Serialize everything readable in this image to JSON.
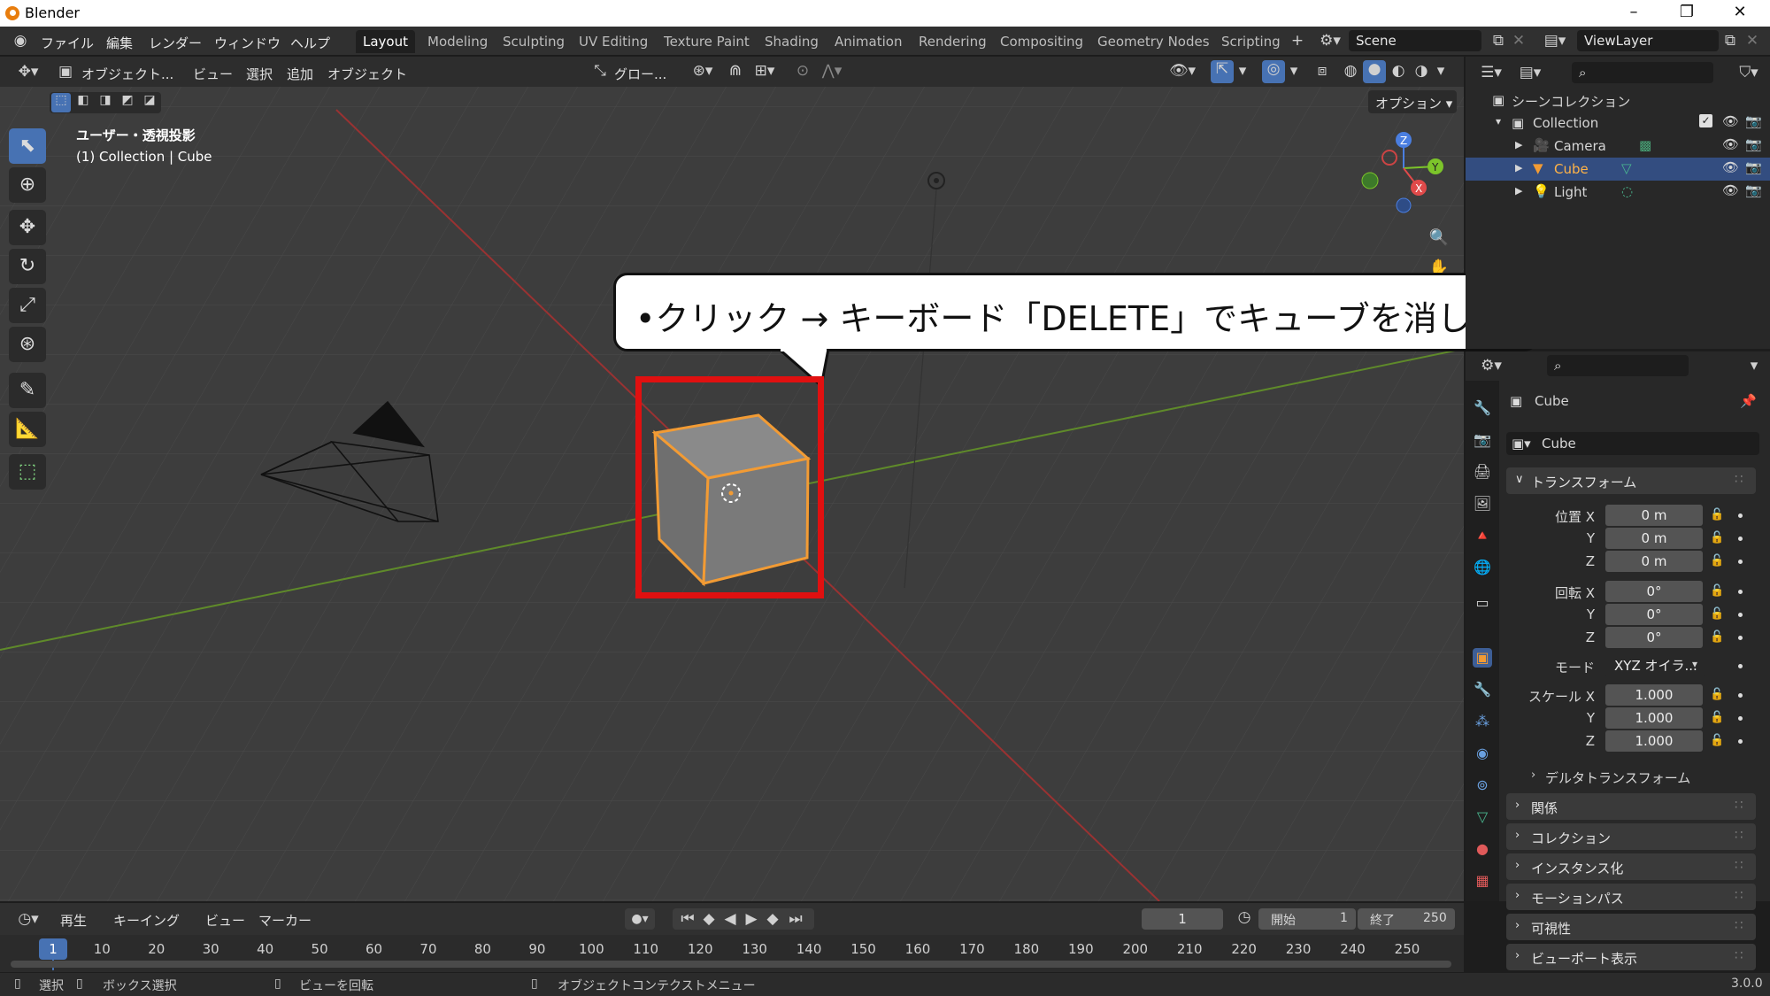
{
  "app": {
    "title": "Blender",
    "version": "3.0.0"
  },
  "menus": [
    "ファイル",
    "編集",
    "レンダー",
    "ウィンドウ",
    "ヘルプ"
  ],
  "workspaces": [
    {
      "label": "Layout",
      "active": true
    },
    {
      "label": "Modeling"
    },
    {
      "label": "Sculpting"
    },
    {
      "label": "UV Editing"
    },
    {
      "label": "Texture Paint"
    },
    {
      "label": "Shading"
    },
    {
      "label": "Animation"
    },
    {
      "label": "Rendering"
    },
    {
      "label": "Compositing"
    },
    {
      "label": "Geometry Nodes"
    },
    {
      "label": "Scripting"
    }
  ],
  "scene": {
    "name": "Scene"
  },
  "view_layer": {
    "name": "ViewLayer"
  },
  "viewport_header": {
    "mode": "オブジェクト...",
    "menus": [
      "ビュー",
      "選択",
      "追加",
      "オブジェクト"
    ],
    "orientation": "グロー...",
    "options": "オプション"
  },
  "viewport": {
    "view_name": "ユーザー・透視投影",
    "collection_info": "(1) Collection | Cube"
  },
  "instruction": {
    "text": "•クリック → キーボード「DELETE」でキューブを消してください"
  },
  "outliner": {
    "root": "シーンコレクション",
    "collection": "Collection",
    "items": [
      {
        "name": "Camera",
        "selected": false
      },
      {
        "name": "Cube",
        "selected": true
      },
      {
        "name": "Light",
        "selected": false
      }
    ]
  },
  "properties": {
    "object_name": "Cube",
    "data_name": "Cube",
    "transform_label": "トランスフォーム",
    "location": {
      "label_x": "位置 X",
      "label_y": "Y",
      "label_z": "Z",
      "x": "0 m",
      "y": "0 m",
      "z": "0 m"
    },
    "rotation": {
      "label_x": "回転 X",
      "label_y": "Y",
      "label_z": "Z",
      "x": "0°",
      "y": "0°",
      "z": "0°"
    },
    "mode": {
      "label": "モード",
      "value": "XYZ オイラ..."
    },
    "scale": {
      "label_x": "スケール X",
      "label_y": "Y",
      "label_z": "Z",
      "x": "1.000",
      "y": "1.000",
      "z": "1.000"
    },
    "delta_transform": "デルタトランスフォーム",
    "sections": [
      "関係",
      "コレクション",
      "インスタンス化",
      "モーションパス",
      "可視性",
      "ビューポート表示"
    ]
  },
  "timeline": {
    "menus": [
      "再生",
      "キーイング",
      "ビュー",
      "マーカー"
    ],
    "current_frame": "1",
    "start_label": "開始",
    "start": "1",
    "end_label": "終了",
    "end": "250",
    "ticks": [
      "1",
      "10",
      "20",
      "30",
      "40",
      "50",
      "60",
      "70",
      "80",
      "90",
      "100",
      "110",
      "120",
      "130",
      "140",
      "150",
      "160",
      "170",
      "180",
      "190",
      "200",
      "210",
      "220",
      "230",
      "240",
      "250"
    ]
  },
  "statusbar": {
    "select": "選択",
    "box_select": "ボックス選択",
    "rotate_view": "ビューを回転",
    "context_menu": "オブジェクトコンテクストメニュー"
  },
  "colors": {
    "accent": "#4772b3",
    "selection": "#334d80",
    "highlight": "#e01010",
    "object_outline": "#f29b34"
  }
}
